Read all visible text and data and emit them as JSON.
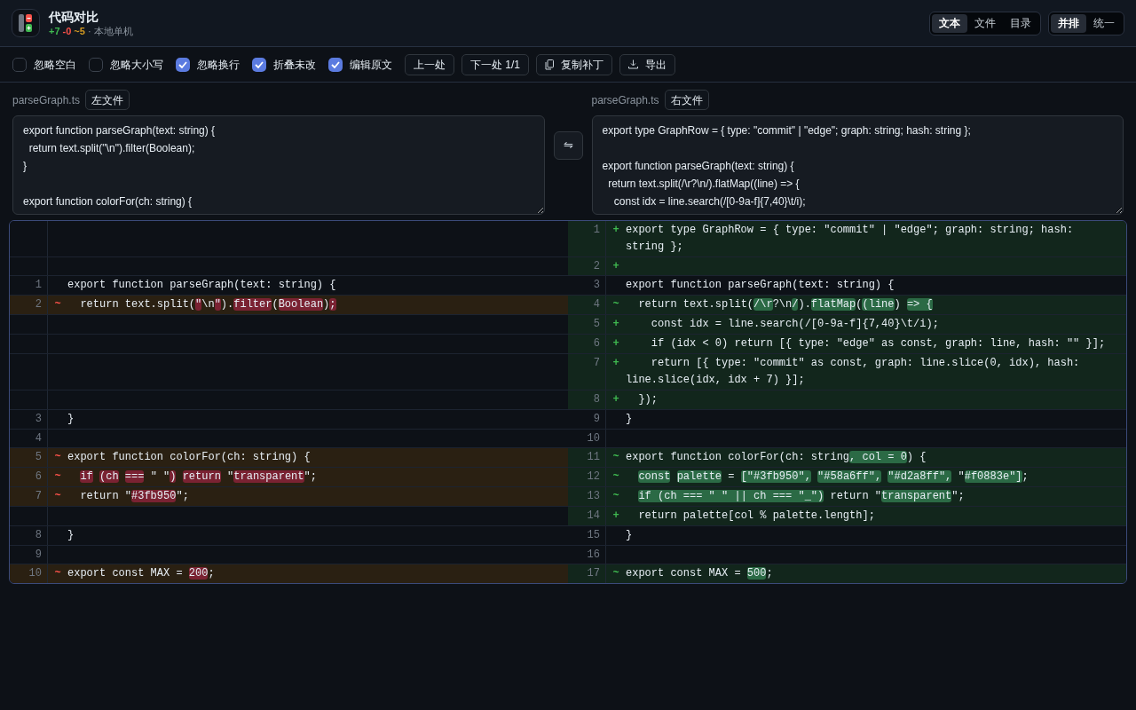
{
  "app": {
    "title": "代码对比",
    "stats": [
      {
        "text": "+7",
        "color": "#3fb950"
      },
      {
        "text": "-0",
        "color": "#f85149"
      },
      {
        "text": "~5",
        "color": "#d29922"
      }
    ],
    "subtitle": "· 本地单机"
  },
  "view_modes": [
    {
      "label": "文本",
      "selected": true
    },
    {
      "label": "文件",
      "selected": false
    },
    {
      "label": "目录",
      "selected": false
    }
  ],
  "layouts": [
    {
      "label": "并排",
      "selected": true
    },
    {
      "label": "统一",
      "selected": false
    }
  ],
  "options": [
    {
      "label": "忽略空白",
      "checked": false
    },
    {
      "label": "忽略大小写",
      "checked": false
    },
    {
      "label": "忽略换行",
      "checked": true
    },
    {
      "label": "折叠未改",
      "checked": true
    },
    {
      "label": "编辑原文",
      "checked": true
    }
  ],
  "toolbar": [
    {
      "label": "上一处"
    },
    {
      "label": "下一处 1/1"
    },
    {
      "label": "复制补丁"
    },
    {
      "label": "导出"
    }
  ],
  "left_file": {
    "name": "parseGraph.ts",
    "button": "左文件",
    "content": "export function parseGraph(text: string) {\n  return text.split(\"\\n\").filter(Boolean);\n}\n\nexport function colorFor(ch: string) {"
  },
  "swap_button": "⇋",
  "right_file": {
    "name": "parseGraph.ts",
    "button": "右文件",
    "content": "export type GraphRow = { type: \"commit\" | \"edge\"; graph: string; hash: string };\n\nexport function parseGraph(text: string) {\n  return text.split(/\\r?\\n/).flatMap((line) => {\n    const idx = line.search(/[0-9a-f]{7,40}\\t/i);"
  },
  "diff_rows": [
    {
      "left": {
        "kind": "filler"
      },
      "right": {
        "kind": "add",
        "number": "1",
        "marker": "+",
        "segments": [
          {
            "text": "export type GraphRow = { type: \"commit\" | \"edge\"; graph: string; hash: string };",
            "changed": false
          }
        ]
      }
    },
    {
      "left": {
        "kind": "filler"
      },
      "right": {
        "kind": "add",
        "number": "2",
        "marker": "+"
      }
    },
    {
      "left": {
        "kind": "context",
        "number": "1",
        "segments": [
          {
            "text": "export function parseGraph(text: string) {",
            "changed": false
          }
        ]
      },
      "right": {
        "kind": "context",
        "number": "3",
        "segments": [
          {
            "text": "export function parseGraph(text: string) {",
            "changed": false
          }
        ]
      }
    },
    {
      "left": {
        "kind": "change",
        "number": "2",
        "marker": "~",
        "segments": [
          {
            "text": "  return text.split(",
            "changed": false
          },
          {
            "text": "\"",
            "changed": true
          },
          {
            "text": "\\n",
            "changed": false
          },
          {
            "text": "\"",
            "changed": true
          },
          {
            "text": ").",
            "changed": false
          },
          {
            "text": "filter",
            "changed": true
          },
          {
            "text": "(",
            "changed": false
          },
          {
            "text": "Boolean",
            "changed": true
          },
          {
            "text": ")",
            "changed": false
          },
          {
            "text": ";",
            "changed": true
          }
        ]
      },
      "right": {
        "kind": "change",
        "number": "4",
        "marker": "~",
        "segments": [
          {
            "text": "  return text.split(",
            "changed": false
          },
          {
            "text": "/\\r",
            "changed": true
          },
          {
            "text": "?\\n",
            "changed": false
          },
          {
            "text": "/",
            "changed": true
          },
          {
            "text": ").",
            "changed": false
          },
          {
            "text": "flatMap",
            "changed": true
          },
          {
            "text": "(",
            "changed": false
          },
          {
            "text": "(line",
            "changed": true
          },
          {
            "text": ")",
            "changed": false
          },
          {
            "text": " => {",
            "changed": true
          }
        ]
      }
    },
    {
      "left": {
        "kind": "filler"
      },
      "right": {
        "kind": "add",
        "number": "5",
        "marker": "+",
        "segments": [
          {
            "text": "    const idx = line.search(/[0-9a-f]{7,40}\\t/i);",
            "changed": false
          }
        ]
      }
    },
    {
      "left": {
        "kind": "filler"
      },
      "right": {
        "kind": "add",
        "number": "6",
        "marker": "+",
        "segments": [
          {
            "text": "    if (idx < 0) return [{ type: \"edge\" as const, graph: line, hash: \"\" }];",
            "changed": false
          }
        ]
      }
    },
    {
      "left": {
        "kind": "filler"
      },
      "right": {
        "kind": "add",
        "number": "7",
        "marker": "+",
        "segments": [
          {
            "text": "    return [{ type: \"commit\" as const, graph: line.slice(0, idx), hash: line.slice(idx, idx + 7) }];",
            "changed": false
          }
        ]
      }
    },
    {
      "left": {
        "kind": "filler"
      },
      "right": {
        "kind": "add",
        "number": "8",
        "marker": "+",
        "segments": [
          {
            "text": "  });",
            "changed": false
          }
        ]
      }
    },
    {
      "left": {
        "kind": "context",
        "number": "3",
        "segments": [
          {
            "text": "}",
            "changed": false
          }
        ]
      },
      "right": {
        "kind": "context",
        "number": "9",
        "segments": [
          {
            "text": "}",
            "changed": false
          }
        ]
      }
    },
    {
      "left": {
        "kind": "context",
        "number": "4"
      },
      "right": {
        "kind": "context",
        "number": "10"
      }
    },
    {
      "left": {
        "kind": "change",
        "number": "5",
        "marker": "~",
        "segments": [
          {
            "text": "export function colorFor(ch: string) {",
            "changed": false
          }
        ]
      },
      "right": {
        "kind": "change",
        "number": "11",
        "marker": "~",
        "segments": [
          {
            "text": "export function colorFor(ch: string",
            "changed": false
          },
          {
            "text": ", col = 0",
            "changed": true
          },
          {
            "text": ") {",
            "changed": false
          }
        ]
      }
    },
    {
      "left": {
        "kind": "change",
        "number": "6",
        "marker": "~",
        "segments": [
          {
            "text": "  if",
            "changed": true
          },
          {
            "text": " (ch",
            "changed": true
          },
          {
            "text": " ===",
            "changed": true
          },
          {
            "text": " \" \"",
            "changed": false
          },
          {
            "text": ")",
            "changed": true
          },
          {
            "text": " return",
            "changed": true
          },
          {
            "text": " \"",
            "changed": false
          },
          {
            "text": "transparent",
            "changed": true
          },
          {
            "text": "\";",
            "changed": false
          }
        ]
      },
      "right": {
        "kind": "change",
        "number": "12",
        "marker": "~",
        "segments": [
          {
            "text": "  const",
            "changed": true
          },
          {
            "text": " palette",
            "changed": true
          },
          {
            "text": " = ",
            "changed": false
          },
          {
            "text": "[\"#3fb950\",",
            "changed": true
          },
          {
            "text": " \"#58a6ff\",",
            "changed": true
          },
          {
            "text": " \"#d2a8ff\",",
            "changed": true
          },
          {
            "text": " \"",
            "changed": false
          },
          {
            "text": "#f0883e\"]",
            "changed": true
          },
          {
            "text": ";",
            "changed": false
          }
        ]
      }
    },
    {
      "left": {
        "kind": "change",
        "number": "7",
        "marker": "~",
        "segments": [
          {
            "text": "  return \"",
            "changed": false
          },
          {
            "text": "#3fb950",
            "changed": true
          },
          {
            "text": "\";",
            "changed": false
          }
        ]
      },
      "right": {
        "kind": "change",
        "number": "13",
        "marker": "~",
        "segments": [
          {
            "text": "  if (ch === \" \" || ch === \"_\")",
            "changed": true
          },
          {
            "text": " return \"",
            "changed": false
          },
          {
            "text": "transparent",
            "changed": true
          },
          {
            "text": "\";",
            "changed": false
          }
        ]
      }
    },
    {
      "left": {
        "kind": "filler"
      },
      "right": {
        "kind": "add",
        "number": "14",
        "marker": "+",
        "segments": [
          {
            "text": "  return palette[col % palette.length];",
            "changed": false
          }
        ]
      }
    },
    {
      "left": {
        "kind": "context",
        "number": "8",
        "segments": [
          {
            "text": "}",
            "changed": false
          }
        ]
      },
      "right": {
        "kind": "context",
        "number": "15",
        "segments": [
          {
            "text": "}",
            "changed": false
          }
        ]
      }
    },
    {
      "left": {
        "kind": "context",
        "number": "9"
      },
      "right": {
        "kind": "context",
        "number": "16"
      }
    },
    {
      "left": {
        "kind": "change",
        "number": "10",
        "marker": "~",
        "segments": [
          {
            "text": "export const MAX = ",
            "changed": false
          },
          {
            "text": "200",
            "changed": true
          },
          {
            "text": ";",
            "changed": false
          }
        ]
      },
      "right": {
        "kind": "change",
        "number": "17",
        "marker": "~",
        "segments": [
          {
            "text": "export const MAX = ",
            "changed": false
          },
          {
            "text": "500",
            "changed": true
          },
          {
            "text": ";",
            "changed": false
          }
        ]
      }
    }
  ]
}
